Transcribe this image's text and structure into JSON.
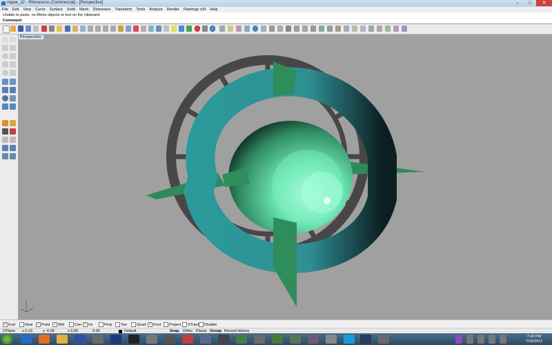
{
  "window": {
    "title": "mqwe_12 - Rhinoceros (Commercial) - [Perspective]"
  },
  "menu": [
    "File",
    "Edit",
    "View",
    "Curve",
    "Surface",
    "Solid",
    "Mesh",
    "Dimension",
    "Transform",
    "Tools",
    "Analyze",
    "Render",
    "Flamingo nXt",
    "Help"
  ],
  "history": {
    "text": "Unable to paste, no Rhino objects or text on the clipboard."
  },
  "command": {
    "label": "Command:",
    "value": ""
  },
  "viewport": {
    "tab_label": "Perspective"
  },
  "osnap": [
    {
      "label": "End",
      "checked": true
    },
    {
      "label": "Near",
      "checked": false
    },
    {
      "label": "Point",
      "checked": true
    },
    {
      "label": "Mid",
      "checked": true
    },
    {
      "label": "Cen",
      "checked": false
    },
    {
      "label": "Int",
      "checked": true
    },
    {
      "label": "Perp",
      "checked": false
    },
    {
      "label": "Tan",
      "checked": false
    },
    {
      "label": "Quad",
      "checked": false
    },
    {
      "label": "Knot",
      "checked": true
    },
    {
      "label": "Project",
      "checked": false
    },
    {
      "label": "STrack",
      "checked": false
    },
    {
      "label": "Disable",
      "checked": false
    }
  ],
  "status": {
    "cplane": "CPlane",
    "x": "x 0.23",
    "y": "y -0.08",
    "z": "z 0.00",
    "units": "0.00",
    "layer": "Default",
    "snap": "Snap",
    "ortho": "Ortho",
    "planar": "Planar",
    "osnap": "Osnap",
    "record": "Record History"
  },
  "clock": {
    "time": "7:43 PM",
    "date": "7/15/2012"
  },
  "colors": {
    "teal_band": "#2a8f8f",
    "ring": "#444444",
    "fins": "#2f8a5a",
    "nacelle": "#6fe8b0",
    "viewport_bg": "#a0a0a0"
  }
}
